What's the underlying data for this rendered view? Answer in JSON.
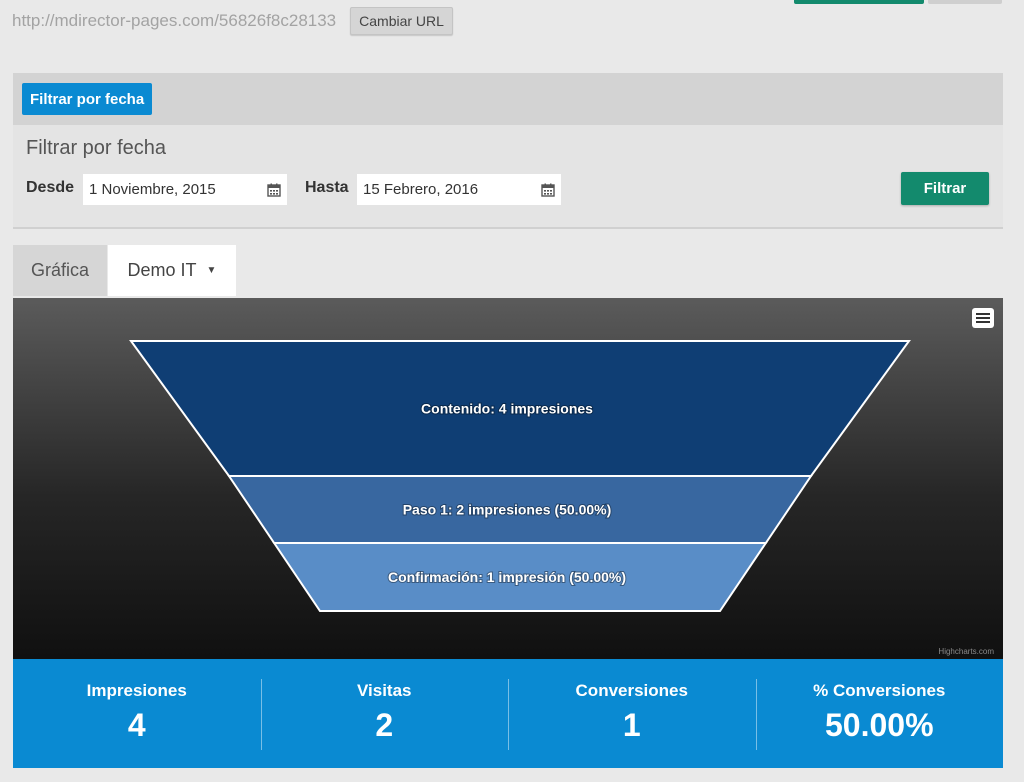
{
  "header": {
    "url": "http://mdirector-pages.com/56826f8c28133",
    "change_url_label": "Cambiar URL"
  },
  "filter": {
    "toggle_label": "Filtrar por fecha",
    "title": "Filtrar por fecha",
    "from_label": "Desde",
    "from_value": "1 Noviembre, 2015",
    "to_label": "Hasta",
    "to_value": "15 Febrero, 2016",
    "apply_label": "Filtrar"
  },
  "tabs": {
    "chart_label": "Gráfica",
    "selected_label": "Demo IT"
  },
  "chart_data": {
    "type": "funnel",
    "stages": [
      {
        "name": "Contenido",
        "value": 4,
        "label": "Contenido: 4 impresiones",
        "color": "#0f3e74"
      },
      {
        "name": "Paso 1",
        "value": 2,
        "label": "Paso 1: 2 impresiones (50.00%)",
        "color": "#3867a0"
      },
      {
        "name": "Confirmación",
        "value": 1,
        "label": "Confirmación: 1 impresión (50.00%)",
        "color": "#598dc7"
      }
    ],
    "credits": "Highcharts.com"
  },
  "stats": [
    {
      "label": "Impresiones",
      "value": "4"
    },
    {
      "label": "Visitas",
      "value": "2"
    },
    {
      "label": "Conversiones",
      "value": "1"
    },
    {
      "label": "% Conversiones",
      "value": "50.00%"
    }
  ],
  "colors": {
    "primary_blue": "#0a8ad2",
    "action_green": "#138a6d"
  },
  "icons": [
    "calendar-icon",
    "menu-icon",
    "caret-down-icon"
  ]
}
